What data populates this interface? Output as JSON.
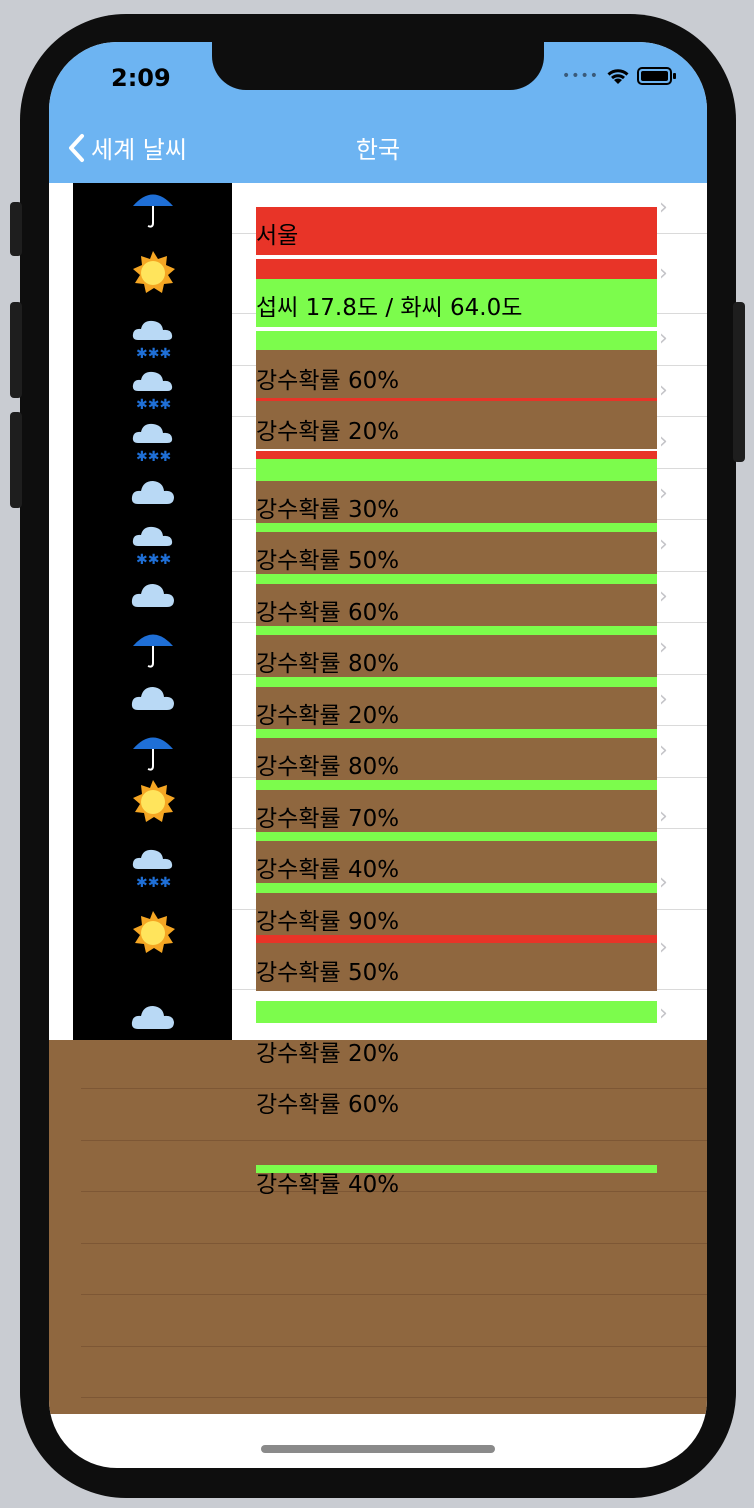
{
  "status": {
    "time": "2:09"
  },
  "nav": {
    "back_label": "세계 날씨",
    "title": "한국"
  },
  "rows": [
    {
      "icon": "umbrella-icon"
    },
    {
      "icon": "sun-icon"
    },
    {
      "icon": "snow-cloud-icon"
    },
    {
      "icon": "snow-cloud-icon"
    },
    {
      "icon": "snow-cloud-icon"
    },
    {
      "icon": "cloud-icon"
    },
    {
      "icon": "snow-cloud-icon"
    },
    {
      "icon": "cloud-icon"
    },
    {
      "icon": "umbrella-icon"
    },
    {
      "icon": "cloud-icon"
    },
    {
      "icon": "umbrella-icon"
    },
    {
      "icon": "sun-icon"
    },
    {
      "icon": "snow-cloud-icon"
    },
    {
      "icon": "sun-icon"
    },
    {
      "icon": "cloud-icon"
    }
  ],
  "labels": {
    "city": "서울",
    "temps_first": "섭씨 17.8도 / 화씨 64.0도",
    "precip": [
      "강수확률 60%",
      "강수확률 20%",
      "강수확률 30%",
      "강수확률 50%",
      "강수확률 60%",
      "강수확률 80%",
      "강수확률 20%",
      "강수확률 80%",
      "강수확률 70%",
      "강수확률 40%",
      "강수확률 90%",
      "강수확률 50%",
      "강수확률 20%",
      "강수확률 60%",
      "강수확률 40%"
    ]
  },
  "colors": {
    "navbar": "#6db4f2",
    "city_band": "#e83428",
    "temp_band": "#7cfc4c",
    "precip_band": "#8f673f"
  }
}
